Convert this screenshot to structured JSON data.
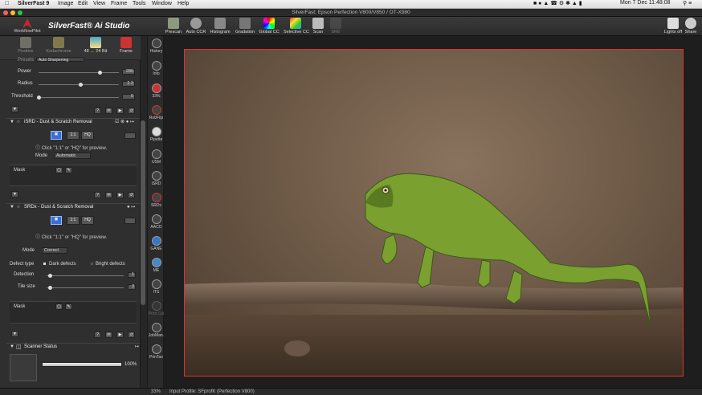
{
  "menubar": {
    "app": "SilverFast 9",
    "items": [
      "Image",
      "Edit",
      "View",
      "Frame",
      "Tools",
      "Window",
      "Help"
    ],
    "datetime": "Mon 7 Dec  11:48:08"
  },
  "window": {
    "title": "SilverFast: Epson Perfection V800/V850 / OT-X980"
  },
  "toolbar": {
    "workflowpilot": "WorkflowPilot",
    "brand": "SilverFast® Ai Studio",
    "modes": [
      {
        "label": "Positive"
      },
      {
        "label": "Kodachrome"
      },
      {
        "label": "48 → 24 Bit"
      },
      {
        "label": "Frame"
      }
    ],
    "tools": [
      {
        "label": "Prescan"
      },
      {
        "label": "Auto CCR"
      },
      {
        "label": "Histogram"
      },
      {
        "label": "Gradation"
      },
      {
        "label": "Global CC"
      },
      {
        "label": "Selective CC"
      },
      {
        "label": "Scan"
      },
      {
        "label": "SRE"
      }
    ],
    "right": [
      {
        "label": "Lights off"
      },
      {
        "label": "Share"
      }
    ]
  },
  "side_tools": [
    {
      "label": "History"
    },
    {
      "label": "Info"
    },
    {
      "label": "33%"
    },
    {
      "label": "Rot/Flip"
    },
    {
      "label": "Pipette"
    },
    {
      "label": "USM"
    },
    {
      "label": "iSRD"
    },
    {
      "label": "SRDx"
    },
    {
      "label": "AACO"
    },
    {
      "label": "GANE"
    },
    {
      "label": "ME"
    },
    {
      "label": "ITS"
    },
    {
      "label": "Print Cal"
    },
    {
      "label": "JobMan."
    },
    {
      "label": "PrinTao"
    }
  ],
  "panel": {
    "top_label": "Presets",
    "top_value": "Auto Sharpening",
    "sliders_top": [
      {
        "label": "Power",
        "value": "280"
      },
      {
        "label": "Radius",
        "value": "2.3"
      },
      {
        "label": "Threshold",
        "value": "0"
      }
    ],
    "isrd": {
      "title": "iSRD - Dust & Scratch Removal",
      "btn_11": "1:1",
      "btn_hq": "HQ",
      "hint": "Click \"1:1\" or \"HQ\" for preview.",
      "mode_label": "Mode",
      "mode_value": "Automatic",
      "mask_label": "Mask"
    },
    "srdx": {
      "title": "SRDx - Dust & Scratch Removal",
      "btn_11": "1:1",
      "btn_hq": "HQ",
      "hint": "Click \"1:1\" or \"HQ\" for preview.",
      "mode_label": "Mode",
      "mode_value": "Correct",
      "defect_label": "Defect type",
      "dark": "Dark defects",
      "bright": "Bright defects",
      "detection_label": "Detection",
      "detection_value": "1",
      "tile_label": "Tile size",
      "tile_value": "3",
      "mask_label": "Mask"
    },
    "scanner_status": {
      "title": "Scanner Status",
      "progress": "100%",
      "progress_value": 1.0
    }
  },
  "status": {
    "zoom": "33%",
    "profile": "Input Profile: SFprofK (Perfection V800)"
  },
  "colors": {
    "frame": "#e0302a",
    "accent": "#3a6fd8"
  }
}
